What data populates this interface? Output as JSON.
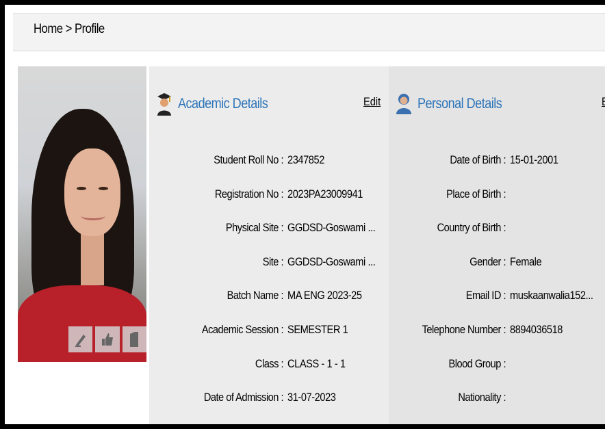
{
  "breadcrumb": "Home > Profile",
  "photo_actions": [
    "edit-photo-icon",
    "like-icon",
    "document-icon"
  ],
  "academic": {
    "title": "Academic Details",
    "edit_label": "Edit",
    "icon": "graduate-icon",
    "rows": [
      {
        "label": "Student Roll No :",
        "value": "2347852"
      },
      {
        "label": "Registration No :",
        "value": "2023PA23009941"
      },
      {
        "label": "Physical Site :",
        "value": "GGDSD-Goswami ..."
      },
      {
        "label": "Site :",
        "value": "GGDSD-Goswami ..."
      },
      {
        "label": "Batch Name :",
        "value": "MA ENG 2023-25"
      },
      {
        "label": "Academic Session :",
        "value": "SEMESTER 1"
      },
      {
        "label": "Class :",
        "value": "CLASS - 1 - 1"
      },
      {
        "label": "Date of Admission :",
        "value": "31-07-2023"
      }
    ]
  },
  "personal": {
    "title": "Personal Details",
    "edit_label": "Ed",
    "icon": "person-icon",
    "rows": [
      {
        "label": "Date of Birth :",
        "value": "15-01-2001"
      },
      {
        "label": "Place of Birth :",
        "value": ""
      },
      {
        "label": "Country of Birth :",
        "value": ""
      },
      {
        "label": "Gender :",
        "value": "Female"
      },
      {
        "label": "Email ID :",
        "value": "muskaanwalia152..."
      },
      {
        "label": "Telephone Number :",
        "value": "8894036518"
      },
      {
        "label": "Blood Group :",
        "value": ""
      },
      {
        "label": "Nationality :",
        "value": ""
      }
    ]
  },
  "colors": {
    "accent": "#2c74b8",
    "academic_bg": "#ececec",
    "personal_bg": "#e4e4e4"
  }
}
